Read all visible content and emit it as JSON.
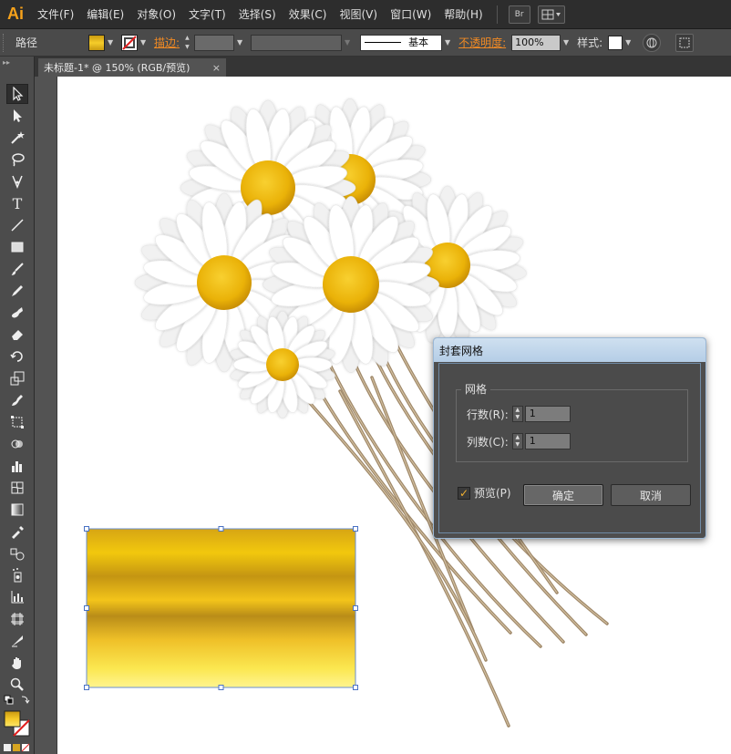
{
  "app": {
    "logo": "Ai",
    "brand_color": "#f7a21b"
  },
  "menu": {
    "items": [
      "文件(F)",
      "编辑(E)",
      "对象(O)",
      "文字(T)",
      "选择(S)",
      "效果(C)",
      "视图(V)",
      "窗口(W)",
      "帮助(H)"
    ],
    "bridge_label": "Br"
  },
  "control_bar": {
    "selection_type": "路径",
    "stroke_label": "描边:",
    "stroke_style": "基本",
    "opacity_label": "不透明度:",
    "opacity_value": "100%",
    "style_label": "样式:"
  },
  "tab": {
    "title": "未标题-1* @ 150% (RGB/预览)",
    "close": "×"
  },
  "toolbox": {
    "tools": [
      "selection-tool",
      "direct-selection-tool",
      "magic-wand-tool",
      "lasso-tool",
      "pen-tool",
      "type-tool",
      "line-tool",
      "rectangle-tool",
      "paintbrush-tool",
      "pencil-tool",
      "blob-brush-tool",
      "eraser-tool",
      "rotate-tool",
      "scale-tool",
      "warp-tool",
      "free-transform-tool",
      "shape-builder-tool",
      "perspective-grid-tool",
      "mesh-tool",
      "gradient-tool",
      "eyedropper-tool",
      "blend-tool",
      "symbol-sprayer-tool",
      "column-graph-tool",
      "artboard-tool",
      "slice-tool",
      "hand-tool",
      "zoom-tool"
    ]
  },
  "dialog": {
    "title": "封套网格",
    "group_label": "网格",
    "rows_label": "行数(R):",
    "rows_value": "1",
    "cols_label": "列数(C):",
    "cols_value": "1",
    "preview_label": "预览(P)",
    "preview_checked": true,
    "ok_label": "确定",
    "cancel_label": "取消"
  },
  "colors": {
    "petal": "#ffffff",
    "flower_center": "#f2b705",
    "stem": "#a0896a",
    "gradient_rect": [
      "#d6a514",
      "#f4c20d",
      "#b78a14",
      "#e0b019",
      "#f8e24a",
      "#fff48c"
    ],
    "dialog_title_bg": "#c4d8ec"
  }
}
